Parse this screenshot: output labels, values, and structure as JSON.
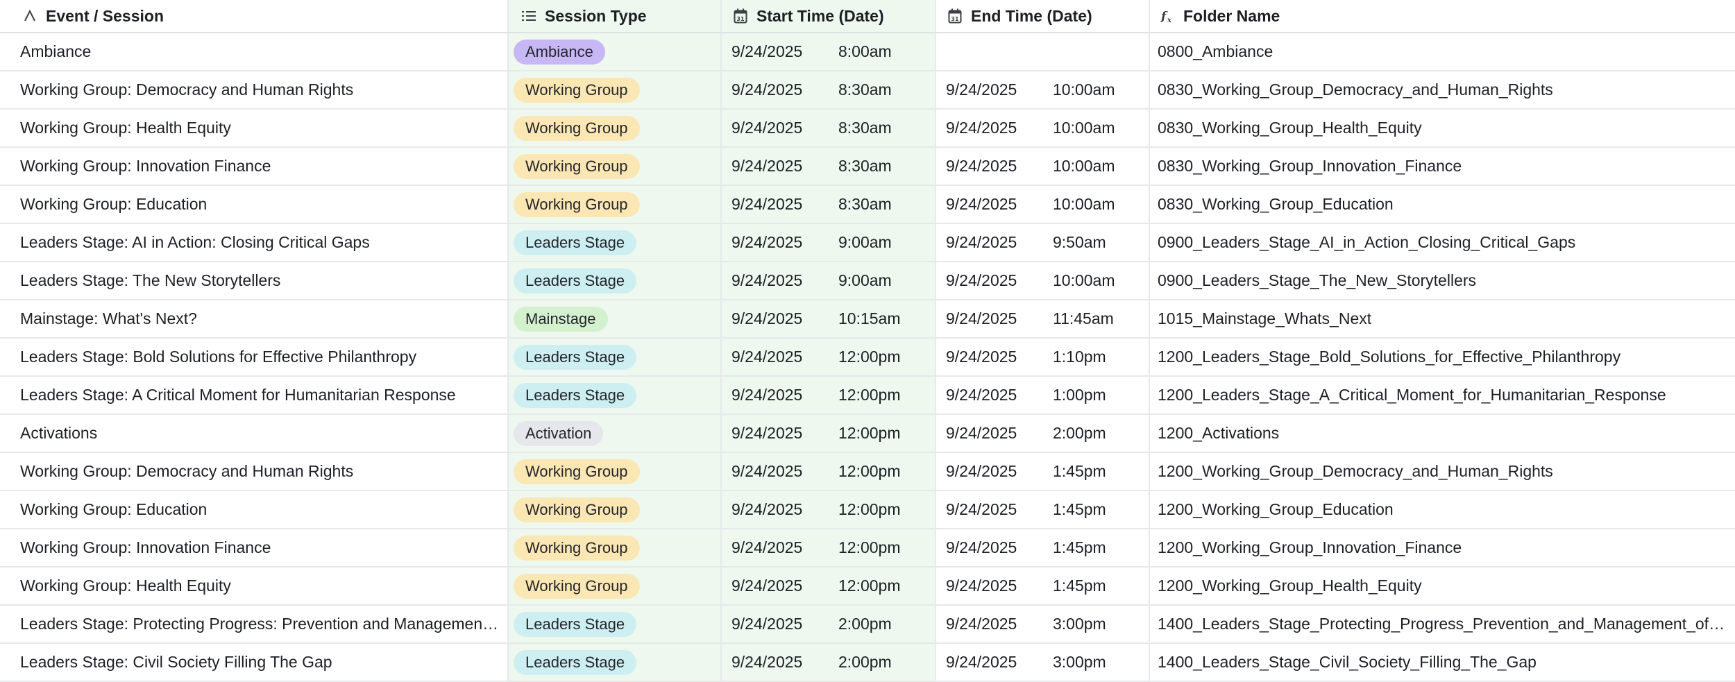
{
  "colors": {
    "Ambiance": "#c7b8f5",
    "Working Group": "#fbe7b4",
    "Leaders Stage": "#cdeff2",
    "Mainstage": "#d3f1cf",
    "Activation": "#e6e7ec"
  },
  "headers": {
    "event": "Event / Session",
    "event_icon": "text-icon",
    "session": "Session Type",
    "session_icon": "single-select-icon",
    "start": "Start Time (Date)",
    "start_icon": "calendar-icon",
    "end": "End Time (Date)",
    "end_icon": "calendar-icon",
    "folder": "Folder Name",
    "folder_icon": "formula-icon"
  },
  "rows": [
    {
      "event": "Ambiance",
      "type": "Ambiance",
      "start_date": "9/24/2025",
      "start_time": "8:00am",
      "end_date": "",
      "end_time": "",
      "folder": "0800_Ambiance"
    },
    {
      "event": "Working Group: Democracy and Human Rights",
      "type": "Working Group",
      "start_date": "9/24/2025",
      "start_time": "8:30am",
      "end_date": "9/24/2025",
      "end_time": "10:00am",
      "folder": "0830_Working_Group_Democracy_and_Human_Rights"
    },
    {
      "event": "Working Group: Health Equity",
      "type": "Working Group",
      "start_date": "9/24/2025",
      "start_time": "8:30am",
      "end_date": "9/24/2025",
      "end_time": "10:00am",
      "folder": "0830_Working_Group_Health_Equity"
    },
    {
      "event": "Working Group: Innovation Finance",
      "type": "Working Group",
      "start_date": "9/24/2025",
      "start_time": "8:30am",
      "end_date": "9/24/2025",
      "end_time": "10:00am",
      "folder": "0830_Working_Group_Innovation_Finance"
    },
    {
      "event": "Working Group: Education",
      "type": "Working Group",
      "start_date": "9/24/2025",
      "start_time": "8:30am",
      "end_date": "9/24/2025",
      "end_time": "10:00am",
      "folder": "0830_Working_Group_Education"
    },
    {
      "event": "Leaders Stage: AI in Action: Closing Critical Gaps",
      "type": "Leaders Stage",
      "start_date": "9/24/2025",
      "start_time": "9:00am",
      "end_date": "9/24/2025",
      "end_time": "9:50am",
      "folder": "0900_Leaders_Stage_AI_in_Action_Closing_Critical_Gaps"
    },
    {
      "event": "Leaders Stage: The New Storytellers",
      "type": "Leaders Stage",
      "start_date": "9/24/2025",
      "start_time": "9:00am",
      "end_date": "9/24/2025",
      "end_time": "10:00am",
      "folder": "0900_Leaders_Stage_The_New_Storytellers"
    },
    {
      "event": "Mainstage: What's Next?",
      "type": "Mainstage",
      "start_date": "9/24/2025",
      "start_time": "10:15am",
      "end_date": "9/24/2025",
      "end_time": "11:45am",
      "folder": "1015_Mainstage_Whats_Next"
    },
    {
      "event": "Leaders Stage: Bold Solutions for Effective Philanthropy",
      "type": "Leaders Stage",
      "start_date": "9/24/2025",
      "start_time": "12:00pm",
      "end_date": "9/24/2025",
      "end_time": "1:10pm",
      "folder": "1200_Leaders_Stage_Bold_Solutions_for_Effective_Philanthropy"
    },
    {
      "event": "Leaders Stage: A Critical Moment for Humanitarian Response",
      "type": "Leaders Stage",
      "start_date": "9/24/2025",
      "start_time": "12:00pm",
      "end_date": "9/24/2025",
      "end_time": "1:00pm",
      "folder": "1200_Leaders_Stage_A_Critical_Moment_for_Humanitarian_Response"
    },
    {
      "event": "Activations",
      "type": "Activation",
      "start_date": "9/24/2025",
      "start_time": "12:00pm",
      "end_date": "9/24/2025",
      "end_time": "2:00pm",
      "folder": "1200_Activations"
    },
    {
      "event": "Working Group: Democracy and Human Rights",
      "type": "Working Group",
      "start_date": "9/24/2025",
      "start_time": "12:00pm",
      "end_date": "9/24/2025",
      "end_time": "1:45pm",
      "folder": "1200_Working_Group_Democracy_and_Human_Rights"
    },
    {
      "event": "Working Group: Education",
      "type": "Working Group",
      "start_date": "9/24/2025",
      "start_time": "12:00pm",
      "end_date": "9/24/2025",
      "end_time": "1:45pm",
      "folder": "1200_Working_Group_Education"
    },
    {
      "event": "Working Group: Innovation Finance",
      "type": "Working Group",
      "start_date": "9/24/2025",
      "start_time": "12:00pm",
      "end_date": "9/24/2025",
      "end_time": "1:45pm",
      "folder": "1200_Working_Group_Innovation_Finance"
    },
    {
      "event": "Working Group: Health Equity",
      "type": "Working Group",
      "start_date": "9/24/2025",
      "start_time": "12:00pm",
      "end_date": "9/24/2025",
      "end_time": "1:45pm",
      "folder": "1200_Working_Group_Health_Equity"
    },
    {
      "event": "Leaders Stage: Protecting Progress: Prevention and Managemen…",
      "type": "Leaders Stage",
      "start_date": "9/24/2025",
      "start_time": "2:00pm",
      "end_date": "9/24/2025",
      "end_time": "3:00pm",
      "folder": "1400_Leaders_Stage_Protecting_Progress_Prevention_and_Management_of…"
    },
    {
      "event": "Leaders Stage: Civil Society Filling The Gap",
      "type": "Leaders Stage",
      "start_date": "9/24/2025",
      "start_time": "2:00pm",
      "end_date": "9/24/2025",
      "end_time": "3:00pm",
      "folder": "1400_Leaders_Stage_Civil_Society_Filling_The_Gap"
    }
  ]
}
